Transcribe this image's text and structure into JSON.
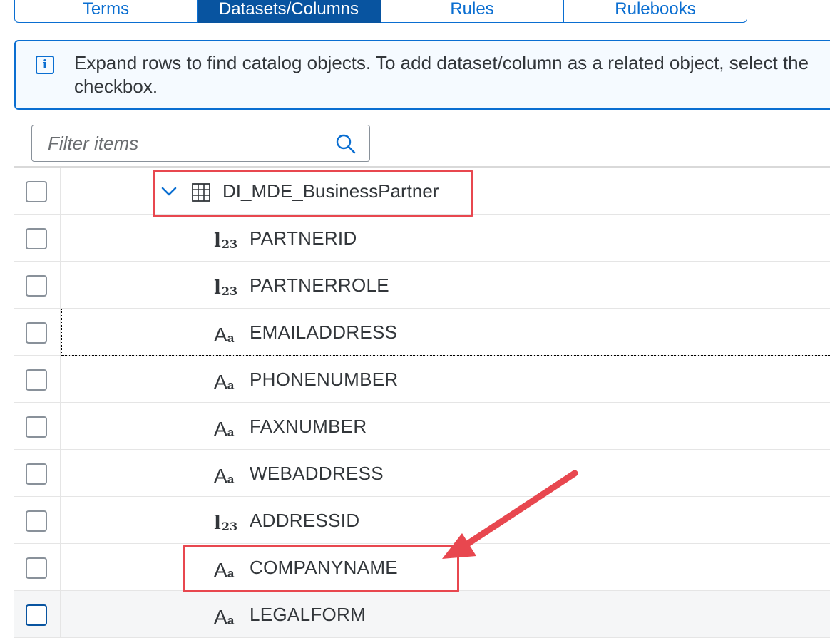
{
  "tabs": [
    {
      "label": "Terms",
      "active": false
    },
    {
      "label": "Datasets/Columns",
      "active": true
    },
    {
      "label": "Rules",
      "active": false
    },
    {
      "label": "Rulebooks",
      "active": false
    }
  ],
  "info": {
    "icon": "info-icon",
    "text": "Expand rows to find catalog objects. To add dataset/column as a related object, select the checkbox."
  },
  "search": {
    "placeholder": "Filter items",
    "value": ""
  },
  "dataset": {
    "name": "DI_MDE_BusinessPartner",
    "expanded": true,
    "icon": "table-icon"
  },
  "columns": [
    {
      "name": "PARTNERID",
      "type": "numeric"
    },
    {
      "name": "PARTNERROLE",
      "type": "numeric"
    },
    {
      "name": "EMAILADDRESS",
      "type": "text"
    },
    {
      "name": "PHONENUMBER",
      "type": "text"
    },
    {
      "name": "FAXNUMBER",
      "type": "text"
    },
    {
      "name": "WEBADDRESS",
      "type": "text"
    },
    {
      "name": "ADDRESSID",
      "type": "numeric"
    },
    {
      "name": "COMPANYNAME",
      "type": "text"
    },
    {
      "name": "LEGALFORM",
      "type": "text"
    }
  ],
  "type_glyphs": {
    "numeric": {
      "big": "l",
      "small": "23"
    },
    "text": {
      "big": "A",
      "small": "a"
    }
  },
  "colors": {
    "accent": "#0a6ed1",
    "active_tab": "#0854a0",
    "highlight": "#e8474f"
  }
}
